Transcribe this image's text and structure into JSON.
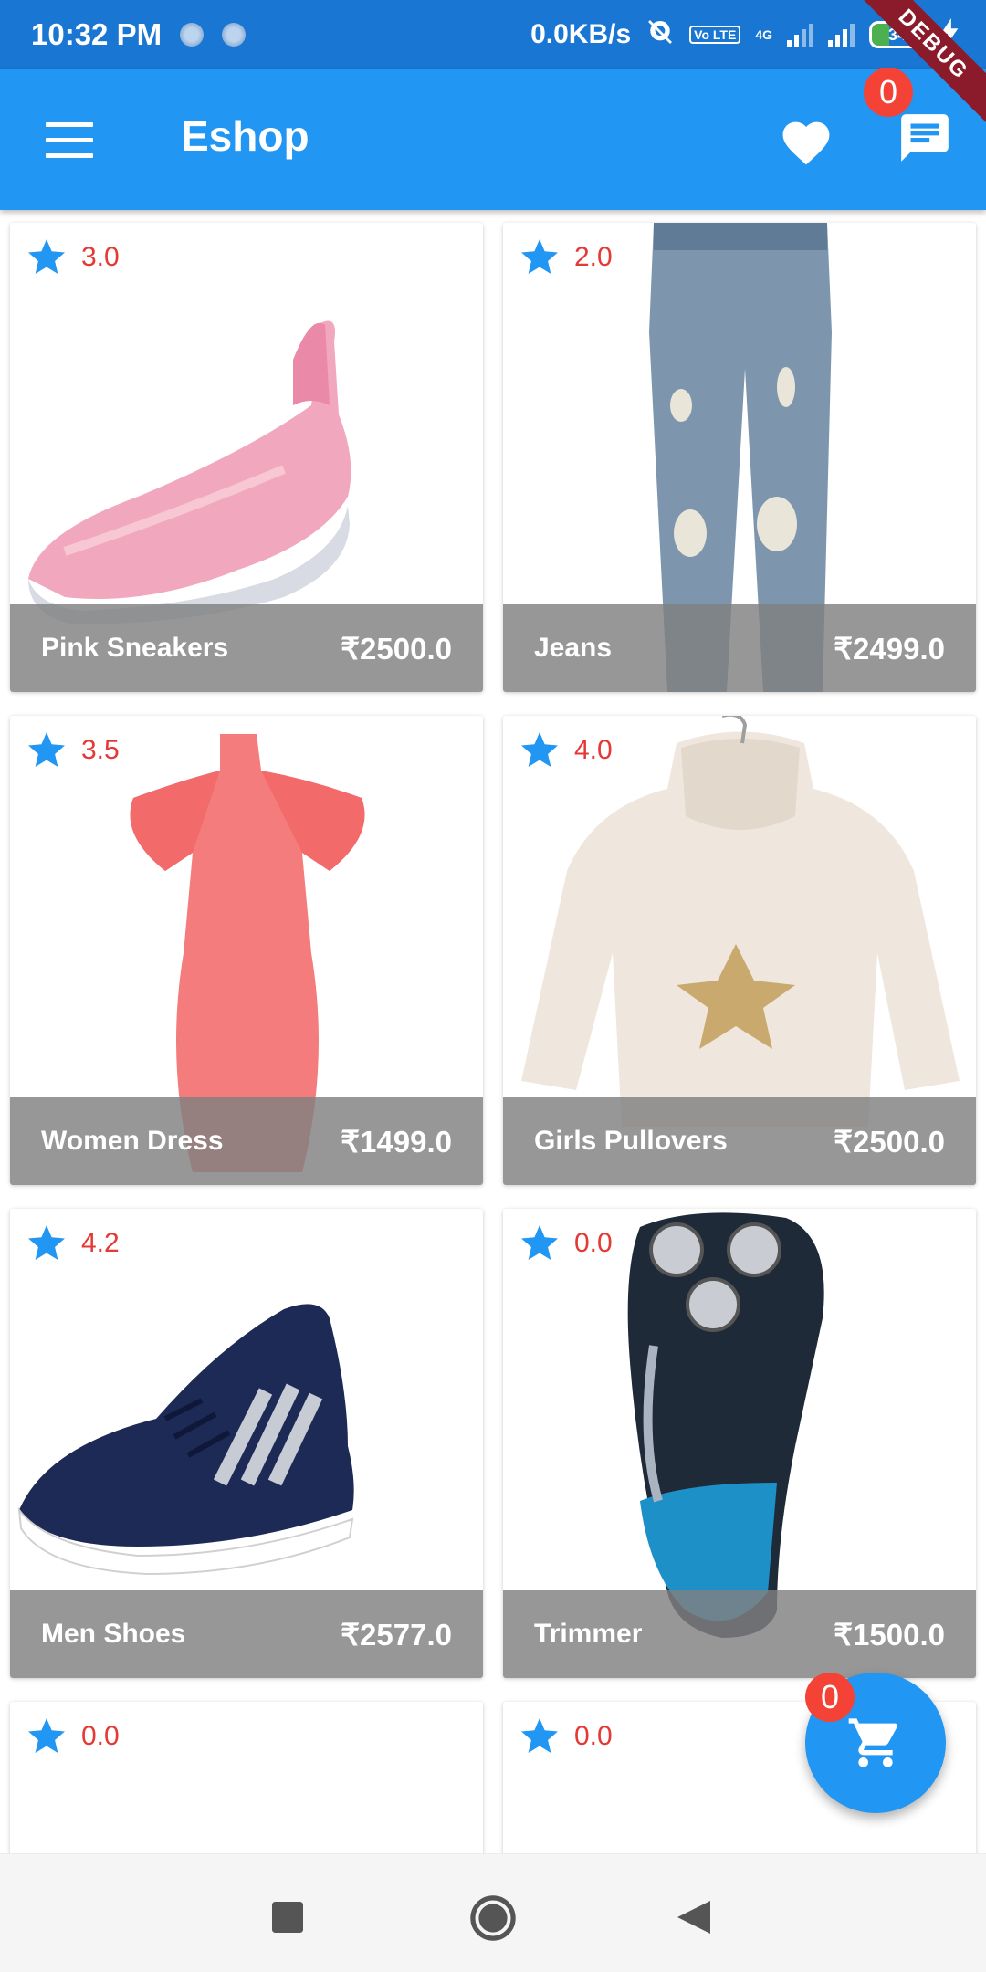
{
  "status_bar": {
    "time": "10:32 PM",
    "speed": "0.0KB/s",
    "lte": "Vo LTE",
    "network": "4G",
    "battery": "34",
    "debug": "DEBUG"
  },
  "app_bar": {
    "title": "Eshop",
    "chat_badge": "0"
  },
  "products": [
    {
      "name": "Pink Sneakers",
      "price": "₹2500.0",
      "rating": "3.0"
    },
    {
      "name": "Jeans",
      "price": "₹2499.0",
      "rating": "2.0"
    },
    {
      "name": "Women Dress",
      "price": "₹1499.0",
      "rating": "3.5"
    },
    {
      "name": "Girls Pullovers",
      "price": "₹2500.0",
      "rating": "4.0"
    },
    {
      "name": "Men Shoes",
      "price": "₹2577.0",
      "rating": "4.2"
    },
    {
      "name": "Trimmer",
      "price": "₹1500.0",
      "rating": "0.0"
    },
    {
      "name": "",
      "price": "",
      "rating": "0.0"
    },
    {
      "name": "",
      "price": "",
      "rating": "0.0"
    }
  ],
  "cart": {
    "badge": "0"
  },
  "colors": {
    "primary": "#2196f3",
    "status_bar": "#1976d2",
    "badge": "#f44336",
    "rating_text": "#e53935"
  }
}
